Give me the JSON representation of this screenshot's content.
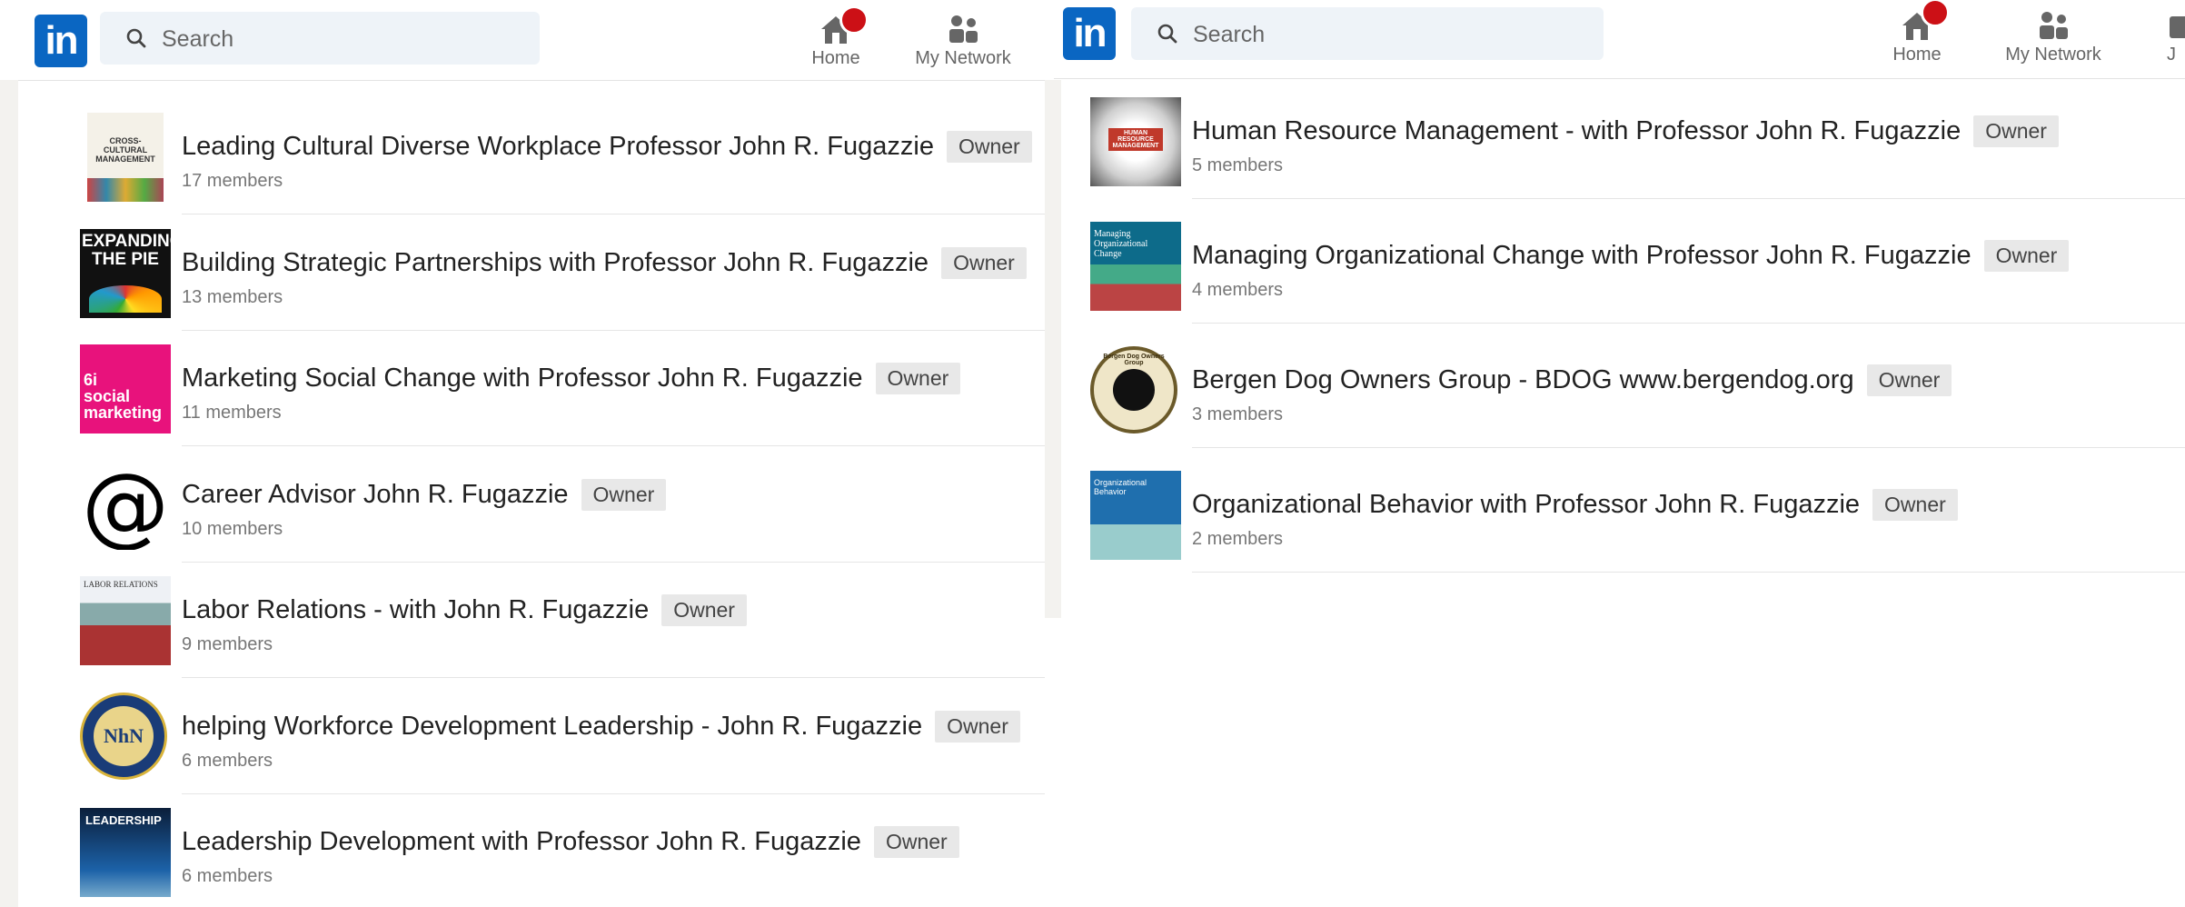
{
  "left": {
    "header": {
      "logo": "in",
      "search_placeholder": "Search",
      "nav": [
        {
          "label": "Home",
          "icon": "home-icon"
        },
        {
          "label": "My Network",
          "icon": "network-icon"
        }
      ]
    },
    "groups": [
      {
        "name": "Leading Cultural Diverse Workplace Professor John R. Fugazzie",
        "badge": "Owner",
        "members": "17 members",
        "thumb": "cross-cultural-management-book",
        "thumb_text": "CROSS-CULTURAL MANAGEMENT"
      },
      {
        "name": "Building Strategic Partnerships with Professor John R. Fugazzie",
        "badge": "Owner",
        "members": "13 members",
        "thumb": "expanding-the-pie-book",
        "thumb_text": "EXPANDING THE PIE"
      },
      {
        "name": "Marketing Social Change with Professor John R. Fugazzie",
        "badge": "Owner",
        "members": "11 members",
        "thumb": "social-marketing-book",
        "thumb_text": "6i social marketing"
      },
      {
        "name": "Career Advisor John R. Fugazzie",
        "badge": "Owner",
        "members": "10 members",
        "thumb": "at-sign",
        "thumb_text": "@"
      },
      {
        "name": "Labor Relations - with John R. Fugazzie",
        "badge": "Owner",
        "members": "9 members",
        "thumb": "labor-relations-book",
        "thumb_text": "LABOR RELATIONS"
      },
      {
        "name": "helping Workforce Development Leadership - John R. Fugazzie",
        "badge": "Owner",
        "members": "6 members",
        "thumb": "nhn-seal",
        "thumb_text": "NhN"
      },
      {
        "name": "Leadership Development with Professor John R. Fugazzie",
        "badge": "Owner",
        "members": "6 members",
        "thumb": "leadership-book",
        "thumb_text": "LEADERSHIP"
      }
    ]
  },
  "right": {
    "header": {
      "logo": "in",
      "search_placeholder": "Search",
      "nav": [
        {
          "label": "Home",
          "icon": "home-icon"
        },
        {
          "label": "My Network",
          "icon": "network-icon"
        },
        {
          "label": "J",
          "icon": "jobs-icon"
        }
      ]
    },
    "groups": [
      {
        "name": "Human Resource Management - with Professor John R. Fugazzie",
        "badge": "Owner",
        "members": "5 members",
        "thumb": "hrm-book",
        "thumb_text": "HUMAN RESOURCE MANAGEMENT"
      },
      {
        "name": "Managing Organizational Change with Professor John R. Fugazzie",
        "badge": "Owner",
        "members": "4 members",
        "thumb": "org-change-book",
        "thumb_text": "Managing Organizational Change"
      },
      {
        "name": "Bergen Dog Owners Group - BDOG www.bergendog.org",
        "badge": "Owner",
        "members": "3 members",
        "thumb": "bdog-seal",
        "thumb_text": "Bergen Dog Owners Group"
      },
      {
        "name": "Organizational Behavior with Professor John R. Fugazzie",
        "badge": "Owner",
        "members": "2 members",
        "thumb": "org-behavior-book",
        "thumb_text": "Organizational Behavior"
      }
    ]
  },
  "colors": {
    "brand": "#0a66c2",
    "badge_bg": "#e8e8e8",
    "notification": "#cc1016"
  }
}
